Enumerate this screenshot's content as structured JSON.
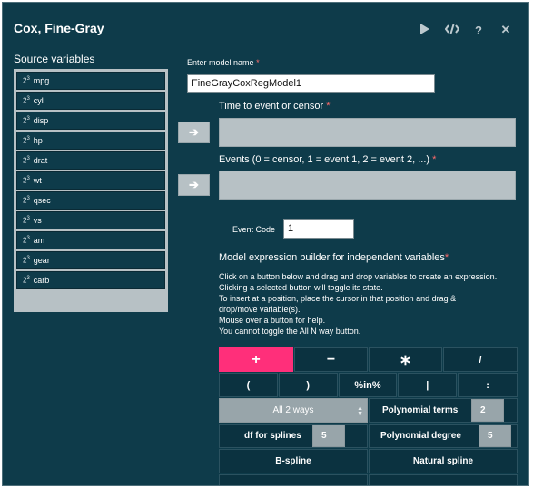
{
  "window": {
    "title": "Cox, Fine-Gray",
    "icons": [
      "play-icon",
      "code-icon",
      "help-icon",
      "close-icon"
    ]
  },
  "source": {
    "label": "Source variables",
    "variables": [
      "mpg",
      "cyl",
      "disp",
      "hp",
      "drat",
      "wt",
      "qsec",
      "vs",
      "am",
      "gear",
      "carb"
    ]
  },
  "model_name": {
    "label": "Enter model name",
    "required_mark": "*",
    "value": "FineGrayCoxRegModel1"
  },
  "time_field": {
    "label": "Time to event or censor",
    "required_mark": "*"
  },
  "events_field": {
    "label": "Events (0 = censor, 1 = event 1, 2 = event 2, ...)",
    "required_mark": "*"
  },
  "event_code": {
    "label": "Event Code",
    "value": "1"
  },
  "builder": {
    "title": "Model expression builder for independent variables",
    "required_mark": "*",
    "help_lines": [
      "Click on a button below and drag and drop variables to create an expression.",
      "Clicking a selected button will toggle its state.",
      "To insert at a position, place the cursor in that position and drag &",
      "drop/move variable(s).",
      "Mouse over a button for help.",
      "You cannot toggle the All N way button."
    ],
    "ops_row1": [
      "+",
      "−",
      "∗",
      "/"
    ],
    "ops_row2": [
      "(",
      ")",
      "%in%",
      "|",
      ":"
    ],
    "all_ways": "All 2 ways",
    "poly_terms_label": "Polynomial terms",
    "poly_terms_value": "2",
    "df_splines_label": "df for splines",
    "df_splines_value": "5",
    "poly_degree_label": "Polynomial degree",
    "poly_degree_value": "5",
    "bspline": "B-spline",
    "natural_spline": "Natural spline"
  },
  "colors": {
    "background": "#0e3b4a",
    "accent": "#ff2f7a",
    "panel": "#b7c1c5"
  }
}
